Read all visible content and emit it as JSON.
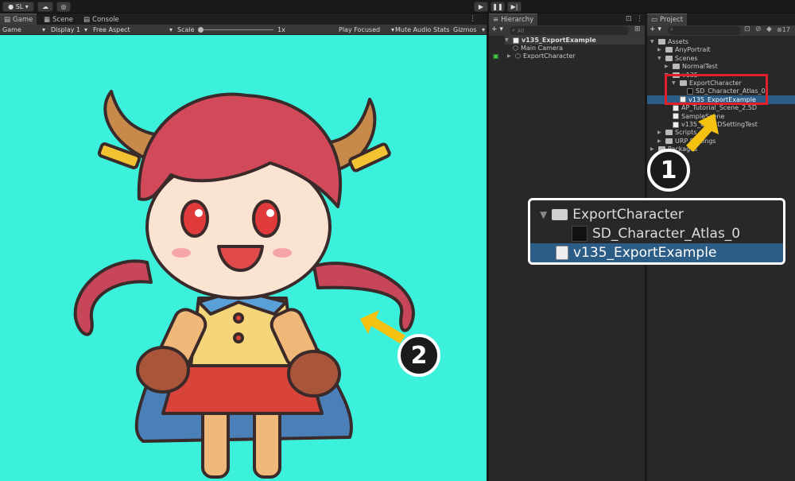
{
  "toolbar": {
    "account_label": "SL",
    "play_icon": "play-icon",
    "pause_icon": "pause-icon",
    "step_icon": "step-icon"
  },
  "left_tabs": [
    "Game",
    "Scene",
    "Console"
  ],
  "game_toolbar": {
    "view_mode": "Game",
    "display": "Display 1",
    "aspect": "Free Aspect",
    "scale_label": "Scale",
    "scale_value": "1x",
    "play_mode": "Play Focused",
    "mute": "Mute Audio",
    "stats": "Stats",
    "gizmos": "Gizmos"
  },
  "hierarchy": {
    "tab": "Hierarchy",
    "search_placeholder": "All",
    "scene_name": "v135_ExportExample",
    "items": [
      "Main Camera",
      "ExportCharacter"
    ]
  },
  "project": {
    "tab": "Project",
    "count": "17",
    "tree": [
      {
        "label": "Assets",
        "indent": 0,
        "kind": "folder",
        "open": true
      },
      {
        "label": "AnyPortrait",
        "indent": 1,
        "kind": "folder",
        "open": false
      },
      {
        "label": "Scenes",
        "indent": 1,
        "kind": "folder",
        "open": true
      },
      {
        "label": "NormalTest",
        "indent": 2,
        "kind": "folder",
        "open": false
      },
      {
        "label": "v135",
        "indent": 2,
        "kind": "folder",
        "open": true
      },
      {
        "label": "ExportCharacter",
        "indent": 3,
        "kind": "folder",
        "open": true
      },
      {
        "label": "SD_Character_Atlas_0",
        "indent": 4,
        "kind": "texture",
        "open": false
      },
      {
        "label": "v135_ExportExample",
        "indent": 3,
        "kind": "scene",
        "selected": true
      },
      {
        "label": "AP_Tutorial_Scene_2.5D",
        "indent": 2,
        "kind": "scene"
      },
      {
        "label": "SampleScene",
        "indent": 2,
        "kind": "scene"
      },
      {
        "label": "v135_URP2DSettingTest",
        "indent": 2,
        "kind": "scene"
      },
      {
        "label": "Scripts",
        "indent": 1,
        "kind": "folder",
        "open": false
      },
      {
        "label": "URP Settings",
        "indent": 1,
        "kind": "folder",
        "open": false
      },
      {
        "label": "Packages",
        "indent": 0,
        "kind": "folder",
        "open": false
      }
    ]
  },
  "zoom": {
    "folder_label": "ExportCharacter",
    "texture_label": "SD_Character_Atlas_0",
    "scene_label": "v135_ExportExample"
  },
  "callouts": {
    "one": "1",
    "two": "2"
  },
  "colors": {
    "game_bg": "#3cf1dc",
    "selection": "#2c5d87",
    "highlight_box": "#e0202a",
    "arrow": "#f5c211"
  }
}
